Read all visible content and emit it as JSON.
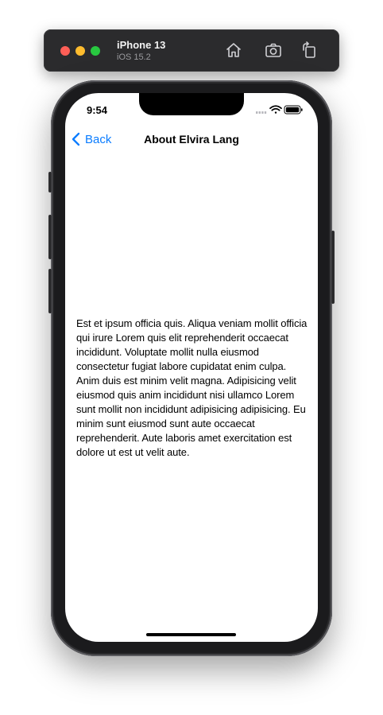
{
  "simulator": {
    "device_name": "iPhone 13",
    "os_version": "iOS 15.2",
    "icons": [
      "home-icon",
      "screenshot-icon",
      "rotate-icon"
    ]
  },
  "status_bar": {
    "time": "9:54",
    "icons": [
      "cellular-icon",
      "wifi-icon",
      "battery-icon"
    ]
  },
  "nav_bar": {
    "back_label": "Back",
    "title": "About Elvira Lang"
  },
  "content": {
    "about_text": "Est et ipsum officia quis. Aliqua veniam mollit officia qui irure Lorem quis elit reprehenderit occaecat incididunt. Voluptate mollit nulla eiusmod consectetur fugiat labore cupidatat enim culpa. Anim duis est minim velit magna. Adipisicing velit eiusmod quis anim incididunt nisi ullamco Lorem sunt mollit non incididunt adipisicing adipisicing. Eu minim sunt eiusmod sunt aute occaecat reprehenderit. Aute laboris amet exercitation est dolore ut est ut velit aute."
  },
  "colors": {
    "accent": "#0a7cff",
    "toolbar": "#2b2b2d",
    "traffic_red": "#fe5f57",
    "traffic_yellow": "#febc2e",
    "traffic_green": "#28c840"
  }
}
